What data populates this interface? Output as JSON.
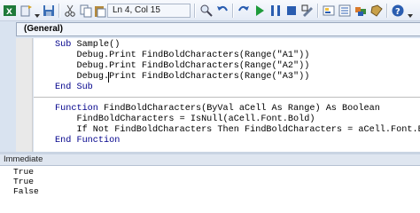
{
  "toolbar": {
    "position_status": "Ln 4, Col 15",
    "buttons": [
      "view-excel-icon",
      "insert-icon",
      "save-icon",
      "cut-icon",
      "copy-icon",
      "paste-icon",
      "find-icon",
      "undo-icon",
      "redo-icon",
      "run-icon",
      "break-icon",
      "reset-icon",
      "design-mode-icon",
      "project-explorer-icon",
      "properties-icon",
      "object-browser-icon",
      "toolbox-icon",
      "help-icon"
    ]
  },
  "editor": {
    "object_combo": "(General)",
    "code_lines": [
      {
        "kw": "Sub",
        "text": " Sample()"
      },
      {
        "kw": "",
        "text": "    Debug.Print FindBoldCharacters(Range(\"A1\"))"
      },
      {
        "kw": "",
        "text": "    Debug.Print FindBoldCharacters(Range(\"A2\"))"
      },
      {
        "kw": "",
        "text": "    Debug.Print FindBoldCharacters(Range(\"A3\"))"
      },
      {
        "kw": "End Sub",
        "text": ""
      },
      {
        "kw": "",
        "text": ""
      },
      {
        "kw": "Function",
        "text": " FindBoldCharacters(ByVal aCell As Range) As Boolean"
      },
      {
        "kw": "",
        "text": "    FindBoldCharacters = IsNull(aCell.Font.Bold)"
      },
      {
        "kw": "",
        "text": "    If Not FindBoldCharacters Then FindBoldCharacters = aCell.Font.Bold"
      },
      {
        "kw": "End Function",
        "text": ""
      }
    ]
  },
  "immediate": {
    "title": "Immediate",
    "lines": [
      "True",
      "True",
      "False"
    ]
  }
}
